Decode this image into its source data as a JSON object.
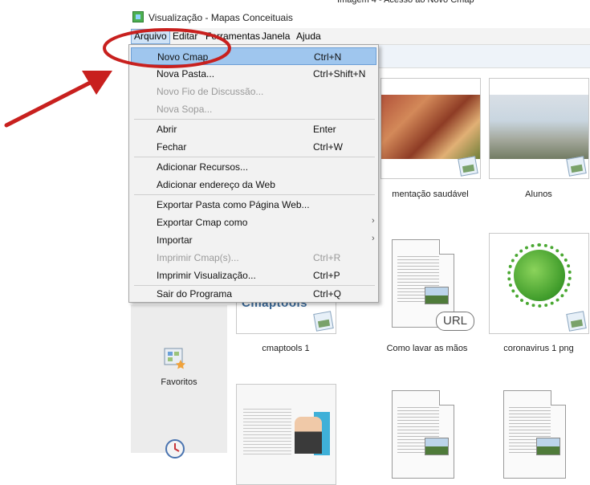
{
  "window": {
    "title": "Visualização - Mapas Conceituais",
    "header_fragment": "Imagem 4 - Acesso ao Novo Cmap"
  },
  "menubar": [
    "Arquivo",
    "Editar",
    "Ferramentas",
    "Janela",
    "Ajuda"
  ],
  "dropdown": {
    "items": [
      {
        "label": "Novo Cmap",
        "shortcut": "Ctrl+N",
        "enabled": true,
        "highlighted": true
      },
      {
        "label": "Nova Pasta...",
        "shortcut": "Ctrl+Shift+N",
        "enabled": true
      },
      {
        "label": "Novo Fio de Discussão...",
        "shortcut": "",
        "enabled": false
      },
      {
        "label": "Nova Sopa...",
        "shortcut": "",
        "enabled": false
      },
      {
        "label": "Abrir",
        "shortcut": "Enter",
        "enabled": true
      },
      {
        "label": "Fechar",
        "shortcut": "Ctrl+W",
        "enabled": true
      },
      {
        "label": "Adicionar Recursos...",
        "shortcut": "",
        "enabled": true
      },
      {
        "label": "Adicionar endereço da Web",
        "shortcut": "",
        "enabled": true
      },
      {
        "label": "Exportar Pasta como Página Web...",
        "shortcut": "",
        "enabled": true
      },
      {
        "label": "Exportar Cmap como",
        "shortcut": "",
        "enabled": true,
        "submenu": true
      },
      {
        "label": "Importar",
        "shortcut": "",
        "enabled": true,
        "submenu": true
      },
      {
        "label": "Imprimir Cmap(s)...",
        "shortcut": "Ctrl+R",
        "enabled": false
      },
      {
        "label": "Imprimir Visualização...",
        "shortcut": "Ctrl+P",
        "enabled": true
      },
      {
        "label": "Sair do Programa",
        "shortcut": "Ctrl+Q",
        "enabled": true
      }
    ]
  },
  "sidebar": {
    "favorites_label": "Favoritos"
  },
  "resources": [
    {
      "label": "mentação saudável"
    },
    {
      "label": "Alunos"
    },
    {
      "label": "cmaptools 1",
      "thumb_text": "Cmaptools"
    },
    {
      "label": "Como lavar as mãos",
      "badge": "URL"
    },
    {
      "label": "coronavirus 1 png"
    }
  ],
  "annotation": {
    "color": "#c8201e"
  }
}
